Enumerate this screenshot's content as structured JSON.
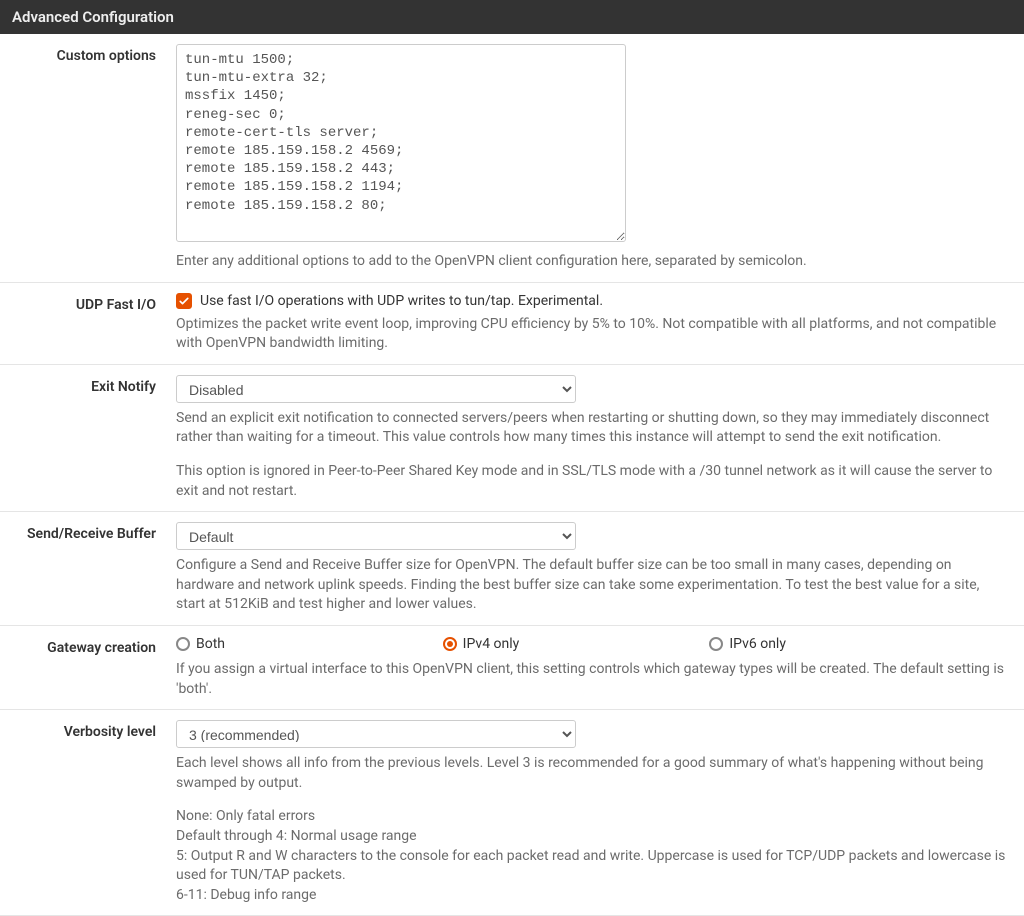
{
  "panel": {
    "title": "Advanced Configuration"
  },
  "custom_options": {
    "label": "Custom options",
    "value": "tun-mtu 1500;\ntun-mtu-extra 32;\nmssfix 1450;\nreneg-sec 0;\nremote-cert-tls server;\nremote 185.159.158.2 4569;\nremote 185.159.158.2 443;\nremote 185.159.158.2 1194;\nremote 185.159.158.2 80;",
    "help": "Enter any additional options to add to the OpenVPN client configuration here, separated by semicolon."
  },
  "udp_fastio": {
    "label": "UDP Fast I/O",
    "checkbox_label": "Use fast I/O operations with UDP writes to tun/tap. Experimental.",
    "checked": true,
    "help": "Optimizes the packet write event loop, improving CPU efficiency by 5% to 10%. Not compatible with all platforms, and not compatible with OpenVPN bandwidth limiting."
  },
  "exit_notify": {
    "label": "Exit Notify",
    "value": "Disabled",
    "help_p1": "Send an explicit exit notification to connected servers/peers when restarting or shutting down, so they may immediately disconnect rather than waiting for a timeout. This value controls how many times this instance will attempt to send the exit notification.",
    "help_p2": "This option is ignored in Peer-to-Peer Shared Key mode and in SSL/TLS mode with a /30 tunnel network as it will cause the server to exit and not restart."
  },
  "send_receive_buffer": {
    "label": "Send/Receive Buffer",
    "value": "Default",
    "help": "Configure a Send and Receive Buffer size for OpenVPN. The default buffer size can be too small in many cases, depending on hardware and network uplink speeds. Finding the best buffer size can take some experimentation. To test the best value for a site, start at 512KiB and test higher and lower values."
  },
  "gateway_creation": {
    "label": "Gateway creation",
    "options": [
      {
        "label": "Both",
        "selected": false
      },
      {
        "label": "IPv4 only",
        "selected": true
      },
      {
        "label": "IPv6 only",
        "selected": false
      }
    ],
    "help": "If you assign a virtual interface to this OpenVPN client, this setting controls which gateway types will be created. The default setting is 'both'."
  },
  "verbosity": {
    "label": "Verbosity level",
    "value": "3 (recommended)",
    "help_p1": "Each level shows all info from the previous levels. Level 3 is recommended for a good summary of what's happening without being swamped by output.",
    "help_p2": "None: Only fatal errors",
    "help_p3": "Default through 4: Normal usage range",
    "help_p4": "5: Output R and W characters to the console for each packet read and write. Uppercase is used for TCP/UDP packets and lowercase is used for TUN/TAP packets.",
    "help_p5": "6-11: Debug info range"
  }
}
